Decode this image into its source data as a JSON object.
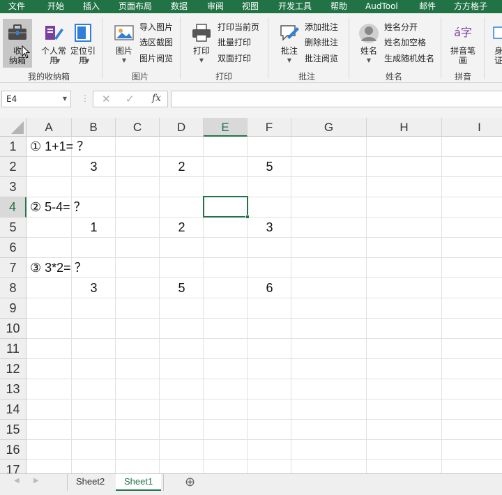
{
  "menu": {
    "tabs": [
      "文件",
      "开始",
      "插入",
      "页面布局",
      "数据",
      "审阅",
      "视图",
      "开发工具",
      "帮助",
      "AudTool",
      "邮件",
      "方方格子"
    ]
  },
  "ribbon": {
    "groups": {
      "my_storage": {
        "label": "我的收纳箱",
        "shoujing": "收\n纳箱",
        "personal": "个人常\n用",
        "position": "定位引\n用"
      },
      "picture": {
        "label": "图片",
        "big": "图片",
        "import": "导入图片",
        "screenshot": "选区截图",
        "browse": "图片阅览"
      },
      "print": {
        "label": "打印",
        "big": "打印",
        "current": "打印当前页",
        "batch": "批量打印",
        "duplex": "双面打印"
      },
      "comment": {
        "label": "批注",
        "big": "批注",
        "add": "添加批注",
        "delete": "删除批注",
        "browse": "批注阅览"
      },
      "name": {
        "label": "姓名",
        "big": "姓名",
        "split": "姓名分开",
        "space": "姓名加空格",
        "random": "生成随机姓名"
      },
      "pinyin": {
        "label": "拼音",
        "big": "拼音笔\n画"
      },
      "partial": {
        "big": "身\n证"
      }
    }
  },
  "formula_bar": {
    "name_box": "E4",
    "cancel": "✕",
    "enter": "✓",
    "fx": "fx",
    "value": ""
  },
  "grid": {
    "columns": [
      "A",
      "B",
      "C",
      "D",
      "E",
      "F",
      "G",
      "H",
      "I"
    ],
    "selected_column": "E",
    "rows": [
      "1",
      "2",
      "3",
      "4",
      "5",
      "6",
      "7",
      "8",
      "9",
      "10",
      "11",
      "12",
      "13",
      "14",
      "15",
      "16",
      "17"
    ],
    "selected_row": "4",
    "cells": {
      "A1": "① 1+1= ？",
      "B2": "3",
      "D2": "2",
      "F2": "5",
      "A4": "② 5-4= ？",
      "B5": "1",
      "D5": "2",
      "F5": "3",
      "A7": "③ 3*2= ？",
      "B8": "3",
      "D8": "5",
      "F8": "6"
    }
  },
  "sheets": {
    "tabs": [
      "Sheet2",
      "Sheet1"
    ],
    "active": "Sheet1",
    "add": "⊕"
  },
  "colors": {
    "excel_green": "#217346"
  }
}
